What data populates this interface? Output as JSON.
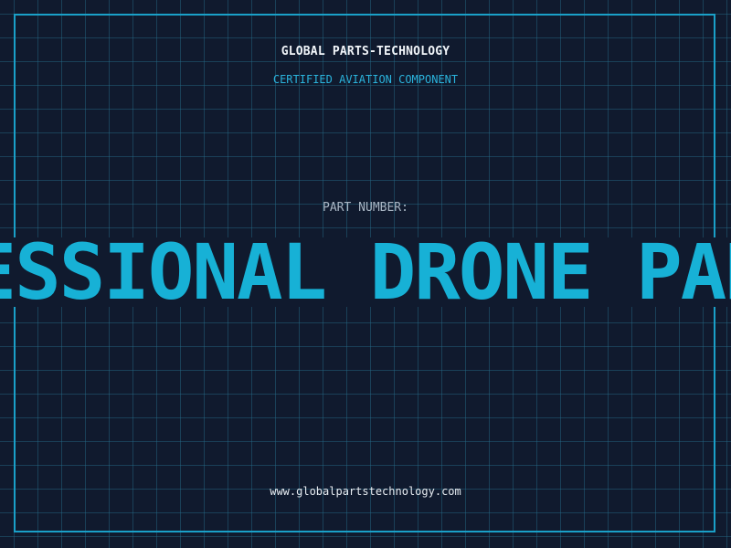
{
  "brand": {
    "name": "GLOBAL PARTS-TECHNOLOGY",
    "tagline": "CERTIFIED AVIATION COMPONENT"
  },
  "part": {
    "label": "PART NUMBER:",
    "value": "PROFESSIONAL DRONE PARTS"
  },
  "footer": {
    "website": "www.globalpartstechnology.com"
  },
  "colors": {
    "background": "#101a2e",
    "grid": "#266e8c",
    "accent": "#17b1d6",
    "frame": "#1aa0c8"
  }
}
